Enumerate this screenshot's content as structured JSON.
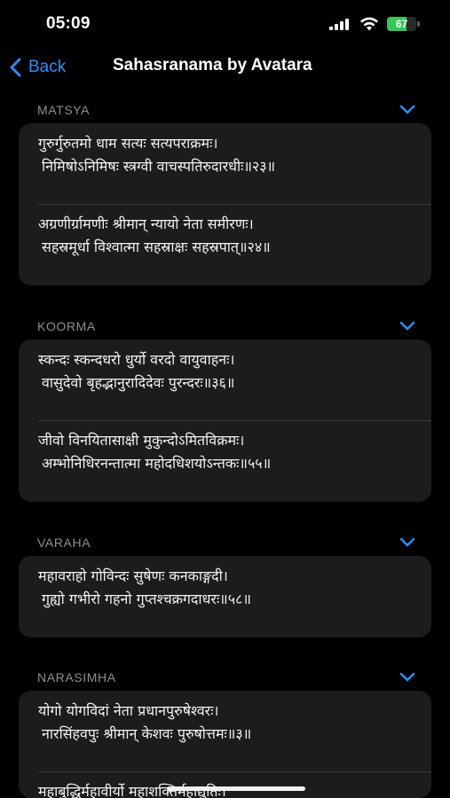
{
  "status_bar": {
    "time": "05:09",
    "battery": "67",
    "battery_level": 0.67
  },
  "nav": {
    "back_label": "Back",
    "title": "Sahasranama by Avatara"
  },
  "sections": [
    {
      "title": "MATSYA",
      "verses": [
        [
          "गुरुर्गुरुतमो धाम सत्यः सत्यपराक्रमः।",
          "निमिषोऽनिमिषः स्त्रग्वी वाचस्पतिरुदारधीः॥२३॥"
        ],
        [
          "अग्रणीर्ग्रामणीः श्रीमान् न्यायो नेता समीरणः।",
          "सहस्रमूर्धा विश्वात्मा सहस्राक्षः सहस्रपात्॥२४॥"
        ]
      ]
    },
    {
      "title": "KOORMA",
      "verses": [
        [
          "स्कन्दः स्कन्दधरो धुर्यो वरदो वायुवाहनः।",
          "वासुदेवो बृहद्भानुरादिदेवः पुरन्दरः॥३६॥"
        ],
        [
          "जीवो विनयितासाक्षी मुकुन्दोऽमितविक्रमः।",
          "अम्भोनिधिरनन्तात्मा महोदधिशयोऽन्तकः॥५५॥"
        ]
      ]
    },
    {
      "title": "VARAHA",
      "verses": [
        [
          "महावराहो गोविन्दः सुषेणः कनकाङ्गदी।",
          "गुह्यो गभीरो गहनो गुप्तश्चक्रगदाधरः॥५८॥"
        ]
      ]
    },
    {
      "title": "NARASIMHA",
      "verses": [
        [
          "योगो योगविदां नेता प्रधानपुरुषेश्वरः।",
          "नारसिंहवपुः श्रीमान् केशवः पुरुषोत्तमः॥३॥"
        ],
        [
          "महाबुद्धिर्महावीर्यो महाशक्तिर्महाद्युतिः।",
          ""
        ]
      ]
    }
  ],
  "colors": {
    "background": "#000000",
    "card": "#1c1c1e",
    "accent": "#2f8cf6",
    "section_header": "#8e8e93",
    "battery_green": "#34c759"
  },
  "icons": {
    "back": "chevron-left-icon",
    "collapse": "chevron-down-icon",
    "signal": "cellular-signal-icon",
    "wifi": "wifi-icon",
    "battery": "battery-icon"
  }
}
